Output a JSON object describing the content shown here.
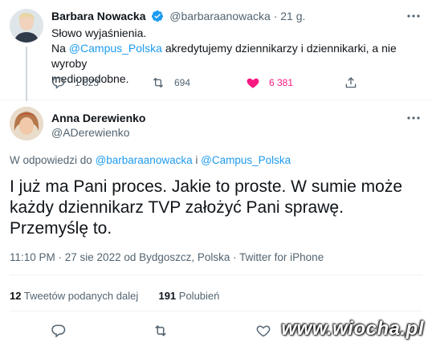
{
  "parent_tweet": {
    "author_name": "Barbara Nowacka",
    "handle": "@barbaraanowacka",
    "separator": "·",
    "time_ago": "21 g.",
    "line1": "Słowo wyjaśnienia.",
    "line2_prefix": "Na ",
    "line2_mention": "@Campus_Polska",
    "line2_suffix": " akredytujemy dziennikarzy i dziennikarki, a nie wyroby",
    "line3": "mediopodobne.",
    "replies": "1 623",
    "retweets": "694",
    "likes": "6 381"
  },
  "main_tweet": {
    "author_name": "Anna Derewienko",
    "handle": "@ADerewienko",
    "reply_prefix": "W odpowiedzi do ",
    "reply_user1": "@barbaraanowacka",
    "reply_conj": " i ",
    "reply_user2": "@Campus_Polska",
    "text": "I już ma Pani proces. Jakie to proste. W sumie może każdy dziennikarz TVP założyć Pani sprawę. Przemyślę to.",
    "meta": "11:10 PM · 27 sie 2022 od Bydgoszcz, Polska · Twitter for iPhone",
    "retweets_count": "12",
    "retweets_label": " Tweetów podanych dalej",
    "likes_count": "191",
    "likes_label": " Polubień"
  },
  "watermark": "www.wiocha.pl",
  "colors": {
    "accent": "#1d9bf0",
    "like": "#f91880",
    "muted": "#536471",
    "text": "#0f1419"
  }
}
